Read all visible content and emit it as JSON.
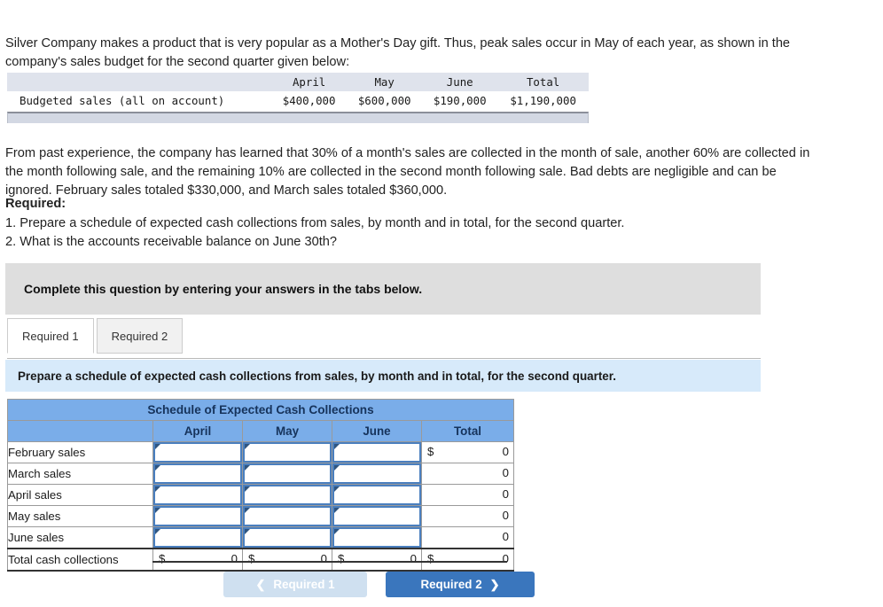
{
  "problem": {
    "intro": "Silver Company makes a product that is very popular as a Mother's Day gift. Thus, peak sales occur in May of each year, as shown in the company's sales budget for the second quarter given below:",
    "paragraph2": "From past experience, the company has learned that 30% of a month's sales are collected in the month of sale, another 60% are collected in the month following sale, and the remaining 10% are collected in the second month following sale. Bad debts are negligible and can be ignored. February sales totaled $330,000, and March sales totaled $360,000.",
    "required_title": "Required:",
    "required_1": "1. Prepare a schedule of expected cash collections from sales, by month and in total, for the second quarter.",
    "required_2": "2. What is the accounts receivable balance on June 30th?"
  },
  "budget_table": {
    "headers": [
      "",
      "April",
      "May",
      "June",
      "Total"
    ],
    "row_label": "Budgeted sales (all on account)",
    "values": [
      "$400,000",
      "$600,000",
      "$190,000",
      "$1,190,000"
    ]
  },
  "banner": {
    "text": "Complete this question by entering your answers in the tabs below."
  },
  "tabs": [
    {
      "label": "Required 1",
      "active": true
    },
    {
      "label": "Required 2",
      "active": false
    }
  ],
  "instruction": {
    "text": "Prepare a schedule of expected cash collections from sales, by month and in total, for the second quarter."
  },
  "schedule": {
    "title": "Schedule of Expected Cash Collections",
    "columns": [
      "April",
      "May",
      "June",
      "Total"
    ],
    "rows": [
      {
        "label": "February sales",
        "april": "",
        "may": "",
        "june": "",
        "total_dollar": "$",
        "total": "0"
      },
      {
        "label": "March sales",
        "april": "",
        "may": "",
        "june": "",
        "total_dollar": "",
        "total": "0"
      },
      {
        "label": "April sales",
        "april": "",
        "may": "",
        "june": "",
        "total_dollar": "",
        "total": "0"
      },
      {
        "label": "May sales",
        "april": "",
        "may": "",
        "june": "",
        "total_dollar": "",
        "total": "0"
      },
      {
        "label": "June sales",
        "april": "",
        "may": "",
        "june": "",
        "total_dollar": "",
        "total": "0"
      }
    ],
    "total_row": {
      "label": "Total cash collections",
      "april_dollar": "$",
      "april": "0",
      "may_dollar": "$",
      "may": "0",
      "june_dollar": "$",
      "june": "0",
      "total_dollar": "$",
      "total": "0"
    }
  },
  "nav": {
    "prev_label": "Required 1",
    "prev_icon": "chevron-left",
    "next_label": "Required 2",
    "next_icon": "chevron-right"
  },
  "colors": {
    "header_blue": "#7aade9",
    "instruction_blue": "#d7eafa",
    "banner_gray": "#dedede",
    "button_blue": "#3a76bd",
    "button_disabled": "#cfe0f0",
    "input_border": "#4a7fbf"
  }
}
